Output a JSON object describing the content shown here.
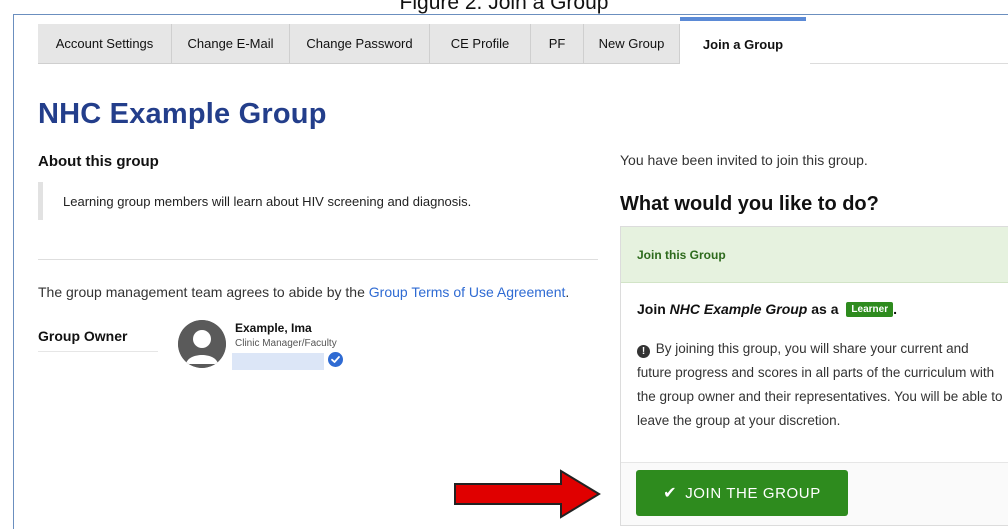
{
  "caption": "Figure 2. Join a Group",
  "tabs": [
    {
      "label": "Account Settings",
      "active": false
    },
    {
      "label": "Change E-Mail",
      "active": false
    },
    {
      "label": "Change Password",
      "active": false
    },
    {
      "label": "CE Profile",
      "active": false
    },
    {
      "label": "PF",
      "active": false
    },
    {
      "label": "New Group",
      "active": false
    },
    {
      "label": "Join a Group",
      "active": true
    }
  ],
  "group": {
    "title": "NHC Example Group",
    "about_heading": "About this group",
    "description": "Learning group members will learn about HIV screening and diagnosis.",
    "terms_prefix": "The group management team agrees to abide by the ",
    "terms_link": "Group Terms of Use Agreement",
    "terms_suffix": ".",
    "owner_label": "Group Owner",
    "owner_name": "Example, Ima",
    "owner_role": "Clinic Manager/Faculty"
  },
  "invite": {
    "invited_text": "You have been invited to join this group.",
    "question": "What would you like to do?",
    "panel_header": "Join this Group",
    "join_prefix": "Join ",
    "join_group_name": "NHC Example Group",
    "join_as": " as a ",
    "role_badge": "Learner",
    "join_suffix": ".",
    "info": "By joining this group, you will share your current and future progress and scores in all parts of the curriculum with the group owner and their representatives. You will be able to leave the group at your discretion.",
    "button_label": "JOIN THE GROUP"
  },
  "colors": {
    "title_blue": "#233e8b",
    "link_blue": "#2f6bd3",
    "success_green": "#2e8b1e",
    "arrow_red": "#e00000"
  },
  "icons": [
    "info-icon",
    "check-icon",
    "verified-badge-icon",
    "arrow-pointer-icon",
    "avatar-placeholder-icon"
  ]
}
